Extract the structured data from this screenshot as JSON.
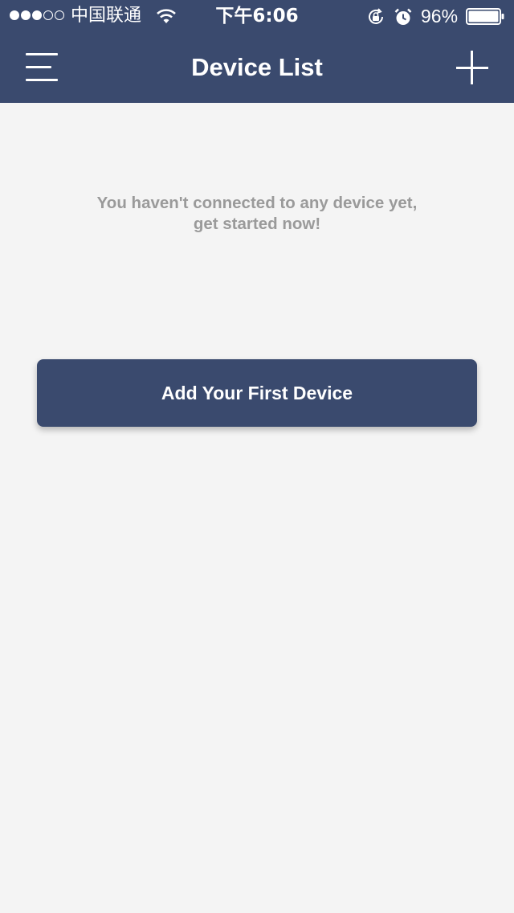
{
  "status_bar": {
    "carrier": "中国联通",
    "signal_bars_filled": 3,
    "signal_bars_total": 5,
    "time": "下午6:06",
    "battery_percent": "96%",
    "battery_level": 0.96,
    "icons": [
      "wifi-icon",
      "rotation-lock-icon",
      "alarm-icon",
      "battery-icon"
    ]
  },
  "nav": {
    "title": "Device List",
    "left_icon": "menu-icon",
    "right_icon": "plus-icon"
  },
  "empty_state": {
    "line1": "You haven't connected to any device yet,",
    "line2": "get started now!"
  },
  "cta": {
    "label": "Add Your First Device"
  },
  "colors": {
    "brand": "#3a4a6e",
    "background": "#f4f4f4",
    "muted_text": "#9a9a9a"
  }
}
